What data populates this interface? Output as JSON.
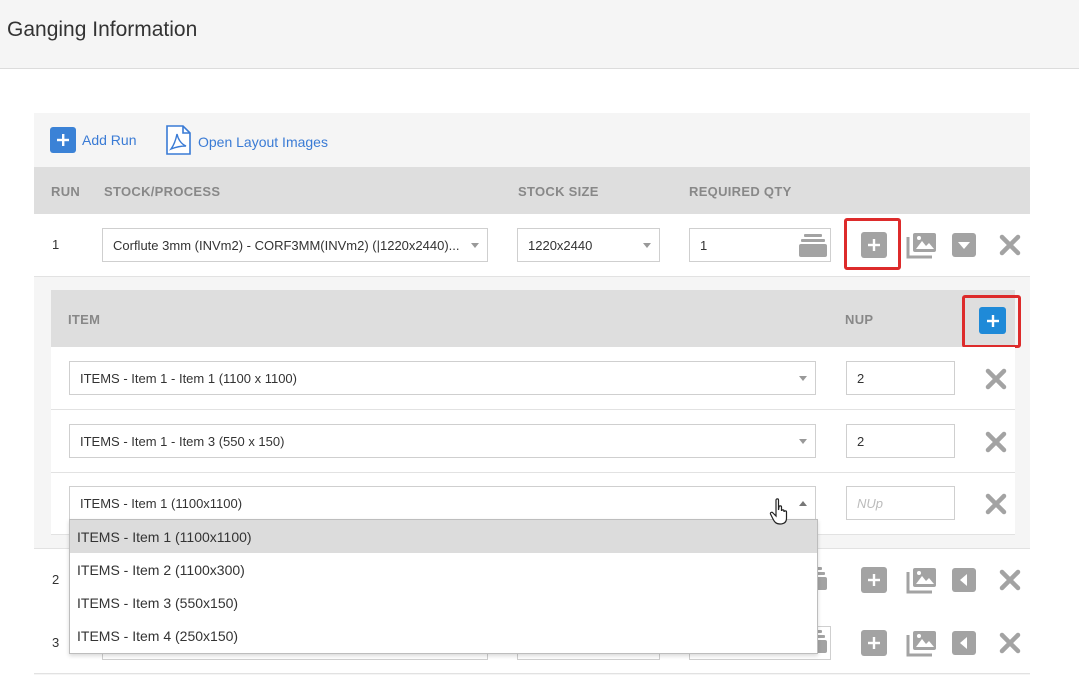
{
  "header": {
    "title": "Ganging Information"
  },
  "toolbar": {
    "add_run_label": "Add Run",
    "open_layout_label": "Open Layout Images"
  },
  "table": {
    "headers": {
      "run": "RUN",
      "stock": "STOCK/PROCESS",
      "size": "STOCK SIZE",
      "qty": "REQUIRED QTY"
    }
  },
  "runs": [
    {
      "num": "1",
      "stock": "Corflute 3mm (INVm2) - CORF3MM(INVm2) (|1220x2440)...",
      "size": "1220x2440",
      "qty": "1"
    },
    {
      "num": "2"
    },
    {
      "num": "3"
    }
  ],
  "items_table": {
    "headers": {
      "item": "ITEM",
      "nup": "NUP"
    },
    "rows": [
      {
        "item": "ITEMS - Item 1 - Item 1 (1100 x 1100)",
        "nup": "2"
      },
      {
        "item": "ITEMS - Item 1 - Item 3 (550 x 150)",
        "nup": "2"
      },
      {
        "item": "ITEMS - Item 1 (1100x1100)",
        "nup_placeholder": "NUp"
      }
    ]
  },
  "dropdown": {
    "options": [
      "ITEMS - Item 1 (1100x1100)",
      "ITEMS - Item 2 (1100x300)",
      "ITEMS - Item 3 (550x150)",
      "ITEMS - Item 4 (250x150)"
    ],
    "selected_index": 0
  },
  "colors": {
    "accent": "#3b82d6",
    "highlight_border": "#dd2b2b",
    "icon_gray": "#a3a3a3"
  }
}
